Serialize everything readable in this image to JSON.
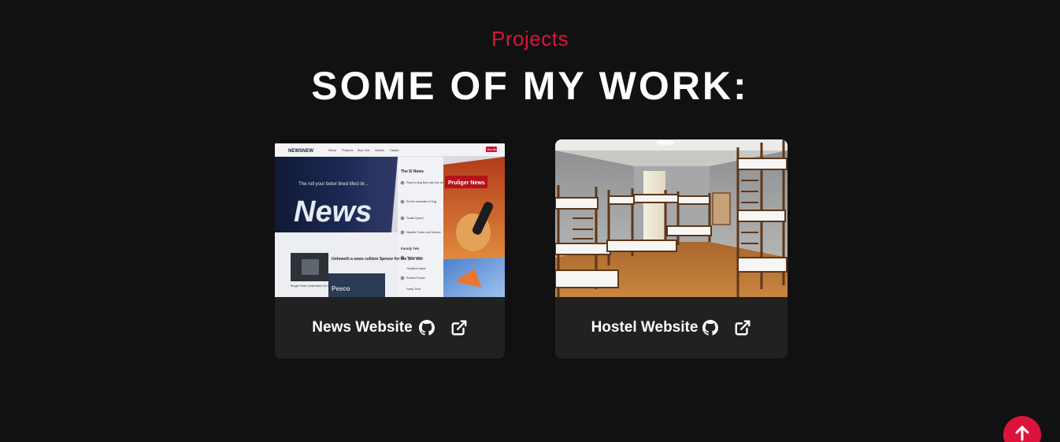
{
  "section": {
    "eyebrow": "Projects",
    "heading": "SOME OF MY WORK:"
  },
  "projects": [
    {
      "title": "News Website",
      "thumbnail_icon": "news-website-screenshot",
      "icons": [
        "github-icon",
        "external-link-icon"
      ]
    },
    {
      "title": "Hostel Website",
      "thumbnail_icon": "hostel-room-photo",
      "icons": [
        "github-icon",
        "external-link-icon"
      ]
    }
  ],
  "thumbnails": {
    "news": {
      "brand": "NEWSNEW",
      "nav": [
        "News",
        "Projects",
        "Buy Vice",
        "Values",
        "Catalo"
      ],
      "cta": "Buy Bar",
      "tagline": "The roll your betor lined lifect br...",
      "headline": "News",
      "sidebar_title": "The 5/ News",
      "side_headline": "Pruliger News",
      "story_headline": "Unfoweth a news celliere Sprieor for the Ses ster",
      "story_caption": "Kinget Yorts Ozdenisted for Bal beling",
      "sidebar_section": "Parody Tels",
      "sidebar_items": [
        "Pead to ding Bee wde five neve",
        "Ra the antutmite of Tugj",
        "Toulist Speeri",
        "Navette Trober cub Sneeze",
        "Trullemanen",
        "Yieldjeret Nade",
        "Rudent Trooke",
        "Frady Thuir"
      ],
      "pesco": "Pesco"
    }
  },
  "colors": {
    "accent": "#dc143c",
    "background": "#121112",
    "card": "#212122",
    "text": "#ffffff"
  },
  "back_to_top": {
    "icon": "arrow-up-icon"
  }
}
